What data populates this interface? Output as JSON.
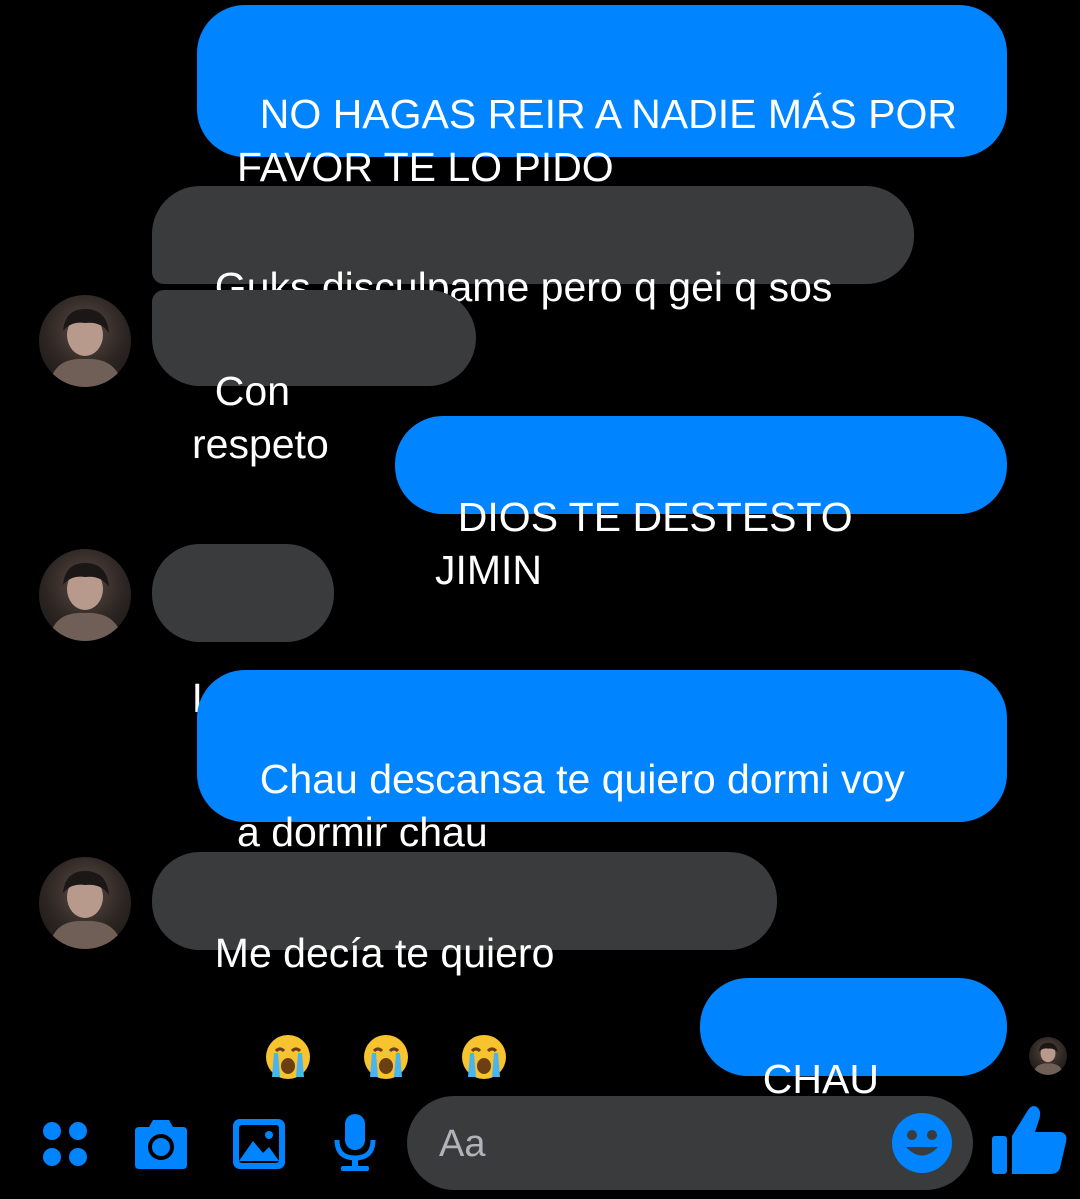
{
  "colors": {
    "accent": "#0084ff",
    "received_bubble": "#3a3b3c",
    "background": "#000000",
    "composer_placeholder": "#b0b3b8"
  },
  "messages": [
    {
      "direction": "sent",
      "text": "NO HAGAS REIR A NADIE MÁS POR\nFAVOR TE LO PIDO"
    },
    {
      "direction": "received",
      "text": "Guks disculpame pero q gei q sos"
    },
    {
      "direction": "received",
      "text": "Con respeto"
    },
    {
      "direction": "sent",
      "text": "DIOS TE DESTESTO JIMIN"
    },
    {
      "direction": "received",
      "text": "Lloro"
    },
    {
      "direction": "sent",
      "text": "Chau descansa te quiero dormi voy\na dormir chau"
    },
    {
      "direction": "received",
      "text": "Me decía te quiero",
      "emoji": [
        "loudly-crying-face",
        "loudly-crying-face",
        "loudly-crying-face"
      ]
    },
    {
      "direction": "sent",
      "text": "CHAU DIJE"
    }
  ],
  "composer": {
    "placeholder": "Aa"
  },
  "toolbar": {
    "icons": [
      "menu-grid-icon",
      "camera-icon",
      "gallery-icon",
      "microphone-icon",
      "emoji-icon",
      "thumbs-up-icon"
    ]
  }
}
